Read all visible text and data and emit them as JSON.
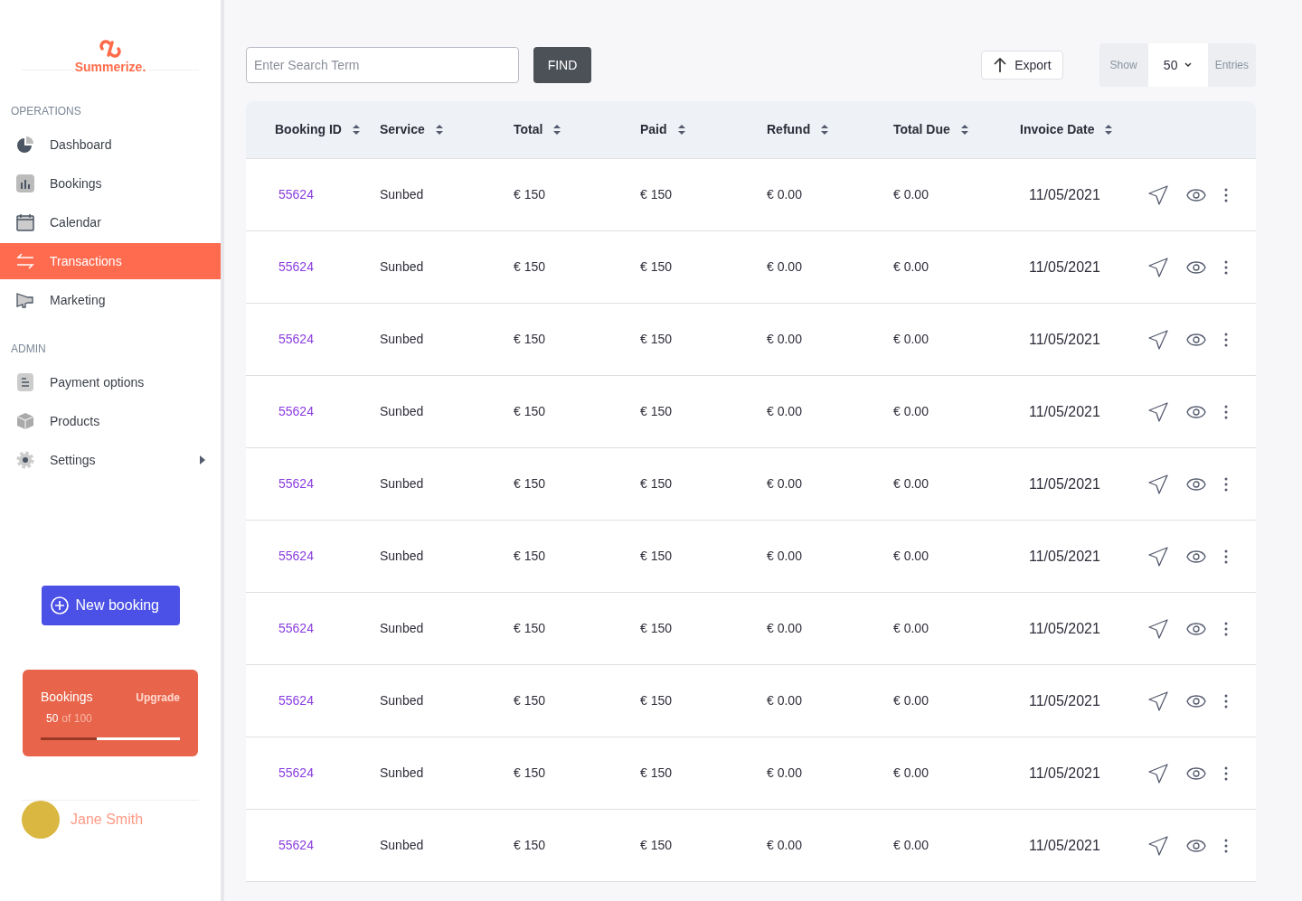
{
  "brand": {
    "name": "Summerize."
  },
  "sidebar": {
    "sections": [
      {
        "title": "OPERATIONS",
        "items": [
          {
            "label": "Dashboard",
            "selected": false
          },
          {
            "label": "Bookings",
            "selected": false
          },
          {
            "label": "Calendar",
            "selected": false
          },
          {
            "label": "Transactions",
            "selected": true
          },
          {
            "label": "Marketing",
            "selected": false
          }
        ]
      },
      {
        "title": "ADMIN",
        "items": [
          {
            "label": "Payment options",
            "selected": false
          },
          {
            "label": "Products",
            "selected": false
          },
          {
            "label": "Settings",
            "selected": false,
            "submenu": true
          }
        ]
      }
    ]
  },
  "new_booking": {
    "label": "New booking"
  },
  "plan": {
    "title": "Bookings",
    "action": "Upgrade",
    "used": "50",
    "of": "of 100",
    "level": 0.4
  },
  "user": {
    "name": "Jane Smith"
  },
  "toolbar": {
    "search": {
      "placeholder": "Enter Search Term"
    },
    "find": "FIND",
    "export": "Export",
    "show": "Show",
    "entries_value": "50",
    "entries": "Entries"
  },
  "table": {
    "columns": [
      "Booking ID",
      "Service",
      "Total",
      "Paid",
      "Refund",
      "Total Due",
      "Invoice Date"
    ],
    "rows": [
      [
        "55624",
        "Sunbed",
        "€ 150",
        "€ 150",
        "€ 0.00",
        "€ 0.00",
        "11/05/2021"
      ],
      [
        "55624",
        "Sunbed",
        "€ 150",
        "€ 150",
        "€ 0.00",
        "€ 0.00",
        "11/05/2021"
      ],
      [
        "55624",
        "Sunbed",
        "€ 150",
        "€ 150",
        "€ 0.00",
        "€ 0.00",
        "11/05/2021"
      ],
      [
        "55624",
        "Sunbed",
        "€ 150",
        "€ 150",
        "€ 0.00",
        "€ 0.00",
        "11/05/2021"
      ],
      [
        "55624",
        "Sunbed",
        "€ 150",
        "€ 150",
        "€ 0.00",
        "€ 0.00",
        "11/05/2021"
      ],
      [
        "55624",
        "Sunbed",
        "€ 150",
        "€ 150",
        "€ 0.00",
        "€ 0.00",
        "11/05/2021"
      ],
      [
        "55624",
        "Sunbed",
        "€ 150",
        "€ 150",
        "€ 0.00",
        "€ 0.00",
        "11/05/2021"
      ],
      [
        "55624",
        "Sunbed",
        "€ 150",
        "€ 150",
        "€ 0.00",
        "€ 0.00",
        "11/05/2021"
      ],
      [
        "55624",
        "Sunbed",
        "€ 150",
        "€ 150",
        "€ 0.00",
        "€ 0.00",
        "11/05/2021"
      ],
      [
        "55624",
        "Sunbed",
        "€ 150",
        "€ 150",
        "€ 0.00",
        "€ 0.00",
        "11/05/2021"
      ]
    ]
  }
}
